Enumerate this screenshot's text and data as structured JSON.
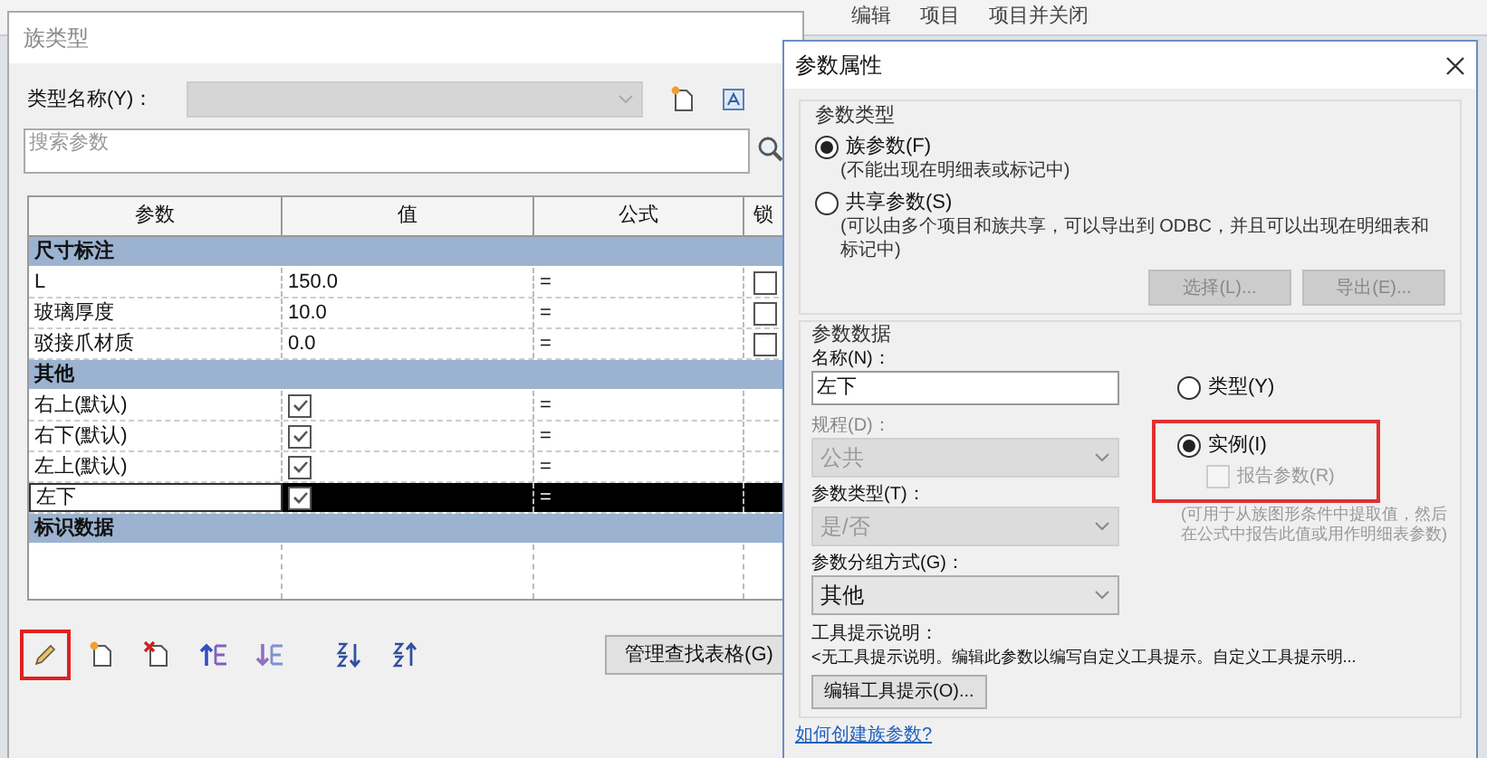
{
  "background": {
    "ribbon_tabs": [
      "编辑",
      "项目",
      "项目并关闭"
    ]
  },
  "family_types": {
    "title": "族类型",
    "type_name_label": "类型名称(Y)：",
    "search": {
      "placeholder": "搜索参数"
    },
    "table": {
      "columns": [
        "参数",
        "值",
        "公式",
        "锁"
      ],
      "groups": [
        {
          "name": "尺寸标注",
          "rows": [
            {
              "param": "L",
              "kind": "text",
              "value": "150.0",
              "formula": "=",
              "locked": false,
              "selected": false
            },
            {
              "param": "玻璃厚度",
              "kind": "text",
              "value": "10.0",
              "formula": "=",
              "locked": false,
              "selected": false
            },
            {
              "param": "驳接爪材质",
              "kind": "text",
              "value": "0.0",
              "formula": "=",
              "locked": false,
              "selected": false
            }
          ]
        },
        {
          "name": "其他",
          "rows": [
            {
              "param": "右上(默认)",
              "kind": "check",
              "checked": true,
              "formula": "=",
              "selected": false
            },
            {
              "param": "右下(默认)",
              "kind": "check",
              "checked": true,
              "formula": "=",
              "selected": false
            },
            {
              "param": "左上(默认)",
              "kind": "check",
              "checked": true,
              "formula": "=",
              "selected": false
            },
            {
              "param": "左下",
              "kind": "check",
              "checked": true,
              "formula": "=",
              "selected": true
            }
          ]
        },
        {
          "name": "标识数据"
        }
      ]
    },
    "toolbar": [
      {
        "kind": "edit",
        "highlighted": true
      },
      {
        "kind": "new",
        "highlighted": false
      },
      {
        "kind": "delete",
        "highlighted": false
      },
      {
        "kind": "up",
        "highlighted": false
      },
      {
        "kind": "down",
        "highlighted": false
      },
      {
        "kind": "sort_asc",
        "highlighted": false
      },
      {
        "kind": "sort_desc",
        "highlighted": false
      }
    ],
    "lookup_button": "管理查找表格(G)"
  },
  "parameter_properties": {
    "title": "参数属性",
    "parameter_type": {
      "legend": "参数类型",
      "options": [
        {
          "label": "族参数(F)",
          "note": "(不能出现在明细表或标记中)",
          "selected": true
        },
        {
          "label": "共享参数(S)",
          "note": "(可以由多个项目和族共享，可以导出到 ODBC，并且可以出现在明细表和标记中)",
          "selected": false
        }
      ],
      "buttons": [
        {
          "label": "选择(L)...",
          "disabled": true
        },
        {
          "label": "导出(E)...",
          "disabled": true
        }
      ]
    },
    "parameter_data": {
      "legend": "参数数据",
      "name_label": "名称(N)：",
      "name_value": "左下",
      "discipline": {
        "label": "规程(D)：",
        "value": "公共",
        "disabled": true
      },
      "param_type": {
        "label": "参数类型(T)：",
        "value": "是/否",
        "disabled": true
      },
      "group": {
        "label": "参数分组方式(G)：",
        "value": "其他",
        "disabled": false
      },
      "scope": [
        {
          "label": "类型(Y)",
          "selected": false,
          "highlighted": false
        },
        {
          "label": "实例(I)",
          "selected": true,
          "highlighted": true
        }
      ],
      "report": {
        "label": "报告参数(R)",
        "checked": false,
        "disabled": true
      },
      "report_note": "(可用于从族图形条件中提取值，然后在公式中报告此值或用作明细表参数)",
      "tooltip_label": "工具提示说明：",
      "tooltip_text": "<无工具提示说明。编辑此参数以编写自定义工具提示。自定义工具提示明...",
      "tooltip_button": "编辑工具提示(O)..."
    },
    "help_link": "如何创建族参数?"
  }
}
